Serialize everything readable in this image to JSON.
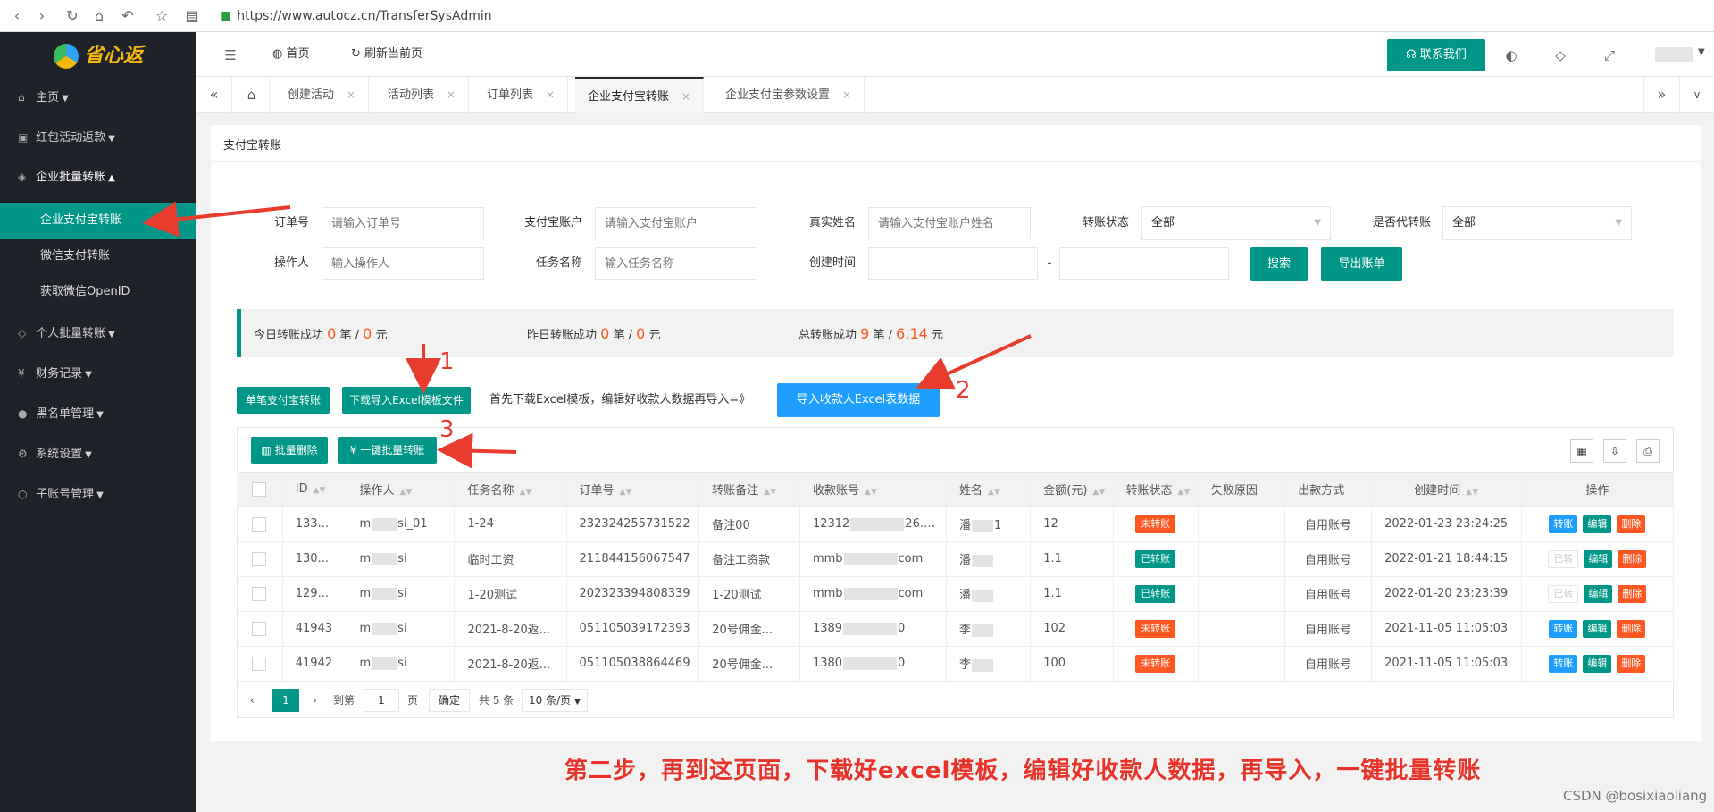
{
  "browser": {
    "url": "https://www.autocz.cn/TransferSysAdmin"
  },
  "logo": {
    "text": "省心返"
  },
  "sidebar": {
    "items": [
      {
        "label": "主页"
      },
      {
        "label": "红包活动返款"
      },
      {
        "label": "企业批量转账"
      },
      {
        "label": "企业支付宝转账"
      },
      {
        "label": "微信支付转账"
      },
      {
        "label": "获取微信OpenID"
      },
      {
        "label": "个人批量转账"
      },
      {
        "label": "财务记录"
      },
      {
        "label": "黑名单管理"
      },
      {
        "label": "系统设置"
      },
      {
        "label": "子账号管理"
      }
    ]
  },
  "header": {
    "home": "首页",
    "refresh": "刷新当前页",
    "contact": "联系我们"
  },
  "tabs": [
    "创建活动",
    "活动列表",
    "订单列表",
    "企业支付宝转账",
    "企业支付宝参数设置"
  ],
  "page": {
    "title": "支付宝转账"
  },
  "filters": {
    "order_label": "订单号",
    "order_ph": "请输入订单号",
    "alipay_label": "支付宝账户",
    "alipay_ph": "请输入支付宝账户",
    "name_label": "真实姓名",
    "name_ph": "请输入支付宝账户姓名",
    "status_label": "转账状态",
    "status_value": "全部",
    "proxy_label": "是否代转账",
    "proxy_value": "全部",
    "operator_label": "操作人",
    "operator_ph": "输入操作人",
    "task_label": "任务名称",
    "task_ph": "输入任务名称",
    "time_label": "创建时间",
    "time_sep": "-",
    "search": "搜索",
    "export": "导出账单"
  },
  "stats": {
    "today_label": "今日转账成功",
    "today_count": "0",
    "today_amount": "0",
    "yesterday_label": "昨日转账成功",
    "yesterday_count": "0",
    "yesterday_amount": "0",
    "total_label": "总转账成功",
    "total_count": "9",
    "total_amount": "6.14",
    "unit_count": "笔",
    "unit_slash": "/",
    "unit_amount": "元"
  },
  "actions": {
    "single": "单笔支付宝转账",
    "download": "下载导入Excel模板文件",
    "tip": "首先下载Excel模板，编辑好收款人数据再导入=》",
    "import": "导入收款人Excel表数据"
  },
  "toolbar": {
    "batch_delete": "批量删除",
    "batch_transfer": "一键批量转账"
  },
  "table": {
    "headers": [
      "ID",
      "操作人",
      "任务名称",
      "订单号",
      "转账备注",
      "收款账号",
      "姓名",
      "金额(元)",
      "转账状态",
      "失败原因",
      "出款方式",
      "创建时间",
      "操作"
    ],
    "rows": [
      {
        "id": "133...",
        "op": "m",
        "op2": "si_01",
        "task": "1-24",
        "order": "232324255731522",
        "remark": "备注00",
        "acc": "12312",
        "acc2": "26.com",
        "name": "潘",
        "name2": "1",
        "amount": "12",
        "status": "未转账",
        "status_type": "red",
        "reason": "",
        "method": "自用账号",
        "time": "2022-01-23 23:24:25",
        "transfer_enabled": true
      },
      {
        "id": "130...",
        "op": "m",
        "op2": "si",
        "task": "临时工资",
        "order": "211844156067547",
        "remark": "备注工资款",
        "acc": "mmb",
        "acc2": "com",
        "name": "潘",
        "name2": "",
        "amount": "1.1",
        "status": "已转账",
        "status_type": "green",
        "reason": "",
        "method": "自用账号",
        "time": "2022-01-21 18:44:15",
        "transfer_enabled": false
      },
      {
        "id": "129...",
        "op": "m",
        "op2": "si",
        "task": "1-20测试",
        "order": "202323394808339",
        "remark": "1-20测试",
        "acc": "mmb",
        "acc2": "com",
        "name": "潘",
        "name2": "",
        "amount": "1.1",
        "status": "已转账",
        "status_type": "green",
        "reason": "",
        "method": "自用账号",
        "time": "2022-01-20 23:23:39",
        "transfer_enabled": false
      },
      {
        "id": "41943",
        "op": "m",
        "op2": "si",
        "task": "2021-8-20返...",
        "order": "051105039172393",
        "remark": "20号佣金...",
        "acc": "1389",
        "acc2": "0",
        "name": "李",
        "name2": "",
        "amount": "102",
        "status": "未转账",
        "status_type": "red",
        "reason": "",
        "method": "自用账号",
        "time": "2021-11-05 11:05:03",
        "transfer_enabled": true
      },
      {
        "id": "41942",
        "op": "m",
        "op2": "si",
        "task": "2021-8-20返...",
        "order": "051105038864469",
        "remark": "20号佣金...",
        "acc": "1380",
        "acc2": "0",
        "name": "李",
        "name2": "",
        "amount": "100",
        "status": "未转账",
        "status_type": "red",
        "reason": "",
        "method": "自用账号",
        "time": "2021-11-05 11:05:03",
        "transfer_enabled": true
      }
    ],
    "op_transfer": "转账",
    "op_transfer_done": "已转",
    "op_edit": "编辑",
    "op_delete": "删除"
  },
  "pagination": {
    "page": "1",
    "goto": "到第",
    "page_input": "1",
    "page_unit": "页",
    "confirm": "确定",
    "total": "共 5 条",
    "per_page": "10 条/页"
  },
  "annotations": {
    "n1": "1",
    "n2": "2",
    "n3": "3",
    "caption": "第二步，再到这页面，下载好excel模板，编辑好收款人数据，再导入，一键批量转账"
  },
  "watermark": "CSDN @bosixiaoliang",
  "colors": {
    "primary": "#009688",
    "blue": "#1e9fff",
    "orange": "#ff5722",
    "sidebar": "#20222a",
    "annotation": "#e83c2f"
  }
}
